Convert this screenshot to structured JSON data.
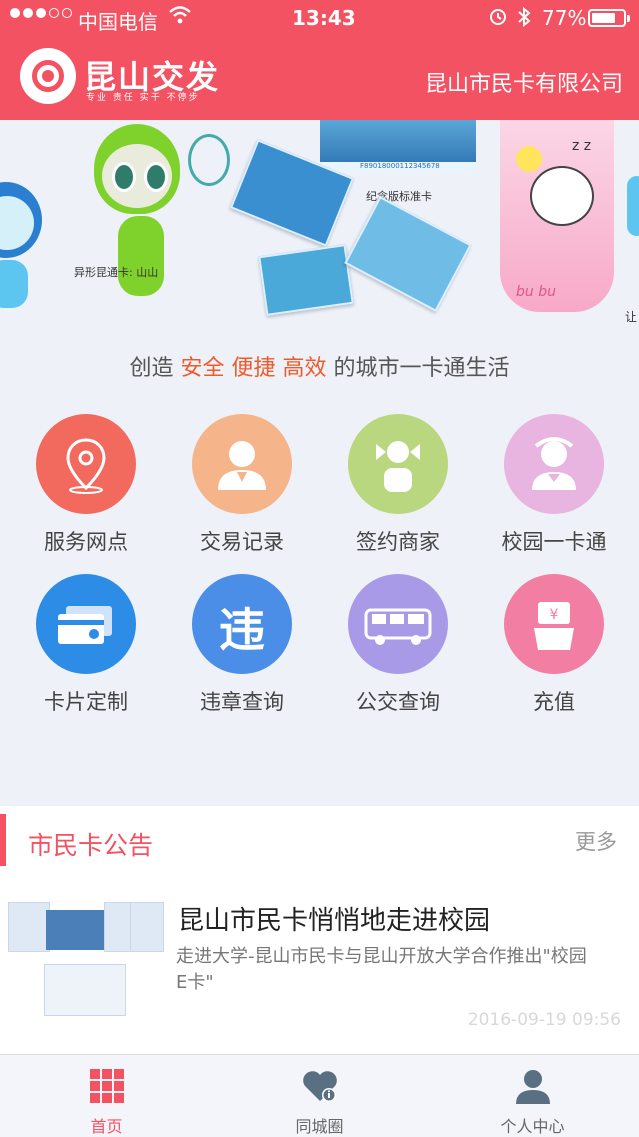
{
  "status_bar": {
    "carrier": "中国电信",
    "time": "13:43",
    "battery_percent": "77%",
    "battery_level": 0.77,
    "signal_filled": 3,
    "signal_total": 5
  },
  "header": {
    "logo_text": "昆山交发",
    "logo_slogan": "专业 责任 实干 不停步",
    "company": "昆山市民卡有限公司",
    "color": "#f25262"
  },
  "banner": {
    "caption_left": "异形昆通卡: 山山",
    "caption_center": "纪念版标准卡",
    "card_number": "F89018000112345678",
    "edge_text": "让"
  },
  "slogan": {
    "prefix": "创造 ",
    "highlight": "安全 便捷 高效",
    "suffix": " 的城市一卡通生活",
    "highlight_color": "#f05a2a"
  },
  "services": [
    {
      "label": "服务网点",
      "icon": "location-pin-icon",
      "color": "#f26a5e"
    },
    {
      "label": "交易记录",
      "icon": "merchant-person-icon",
      "color": "#f5b48a"
    },
    {
      "label": "签约商家",
      "icon": "candy-person-icon",
      "color": "#b9d77e"
    },
    {
      "label": "校园一卡通",
      "icon": "student-icon",
      "color": "#e8b4e0"
    },
    {
      "label": "卡片定制",
      "icon": "cards-icon",
      "color": "#2d8ce6"
    },
    {
      "label": "违章查询",
      "icon": "violation-icon",
      "color": "#4a8ee8",
      "glyph": "违"
    },
    {
      "label": "公交查询",
      "icon": "bus-icon",
      "color": "#a99ae8"
    },
    {
      "label": "充值",
      "icon": "recharge-icon",
      "color": "#f27ea4"
    }
  ],
  "notice": {
    "title": "市民卡公告",
    "more": "更多",
    "news": {
      "title": "昆山市民卡悄悄地走进校园",
      "desc": "走进大学-昆山市民卡与昆山开放大学合作推出\"校园E卡\"",
      "time": "2016-09-19 09:56"
    }
  },
  "tabs": [
    {
      "label": "首页",
      "icon": "grid-icon",
      "active": true
    },
    {
      "label": "同城圈",
      "icon": "heart-icon",
      "active": false
    },
    {
      "label": "个人中心",
      "icon": "person-icon",
      "active": false
    }
  ]
}
